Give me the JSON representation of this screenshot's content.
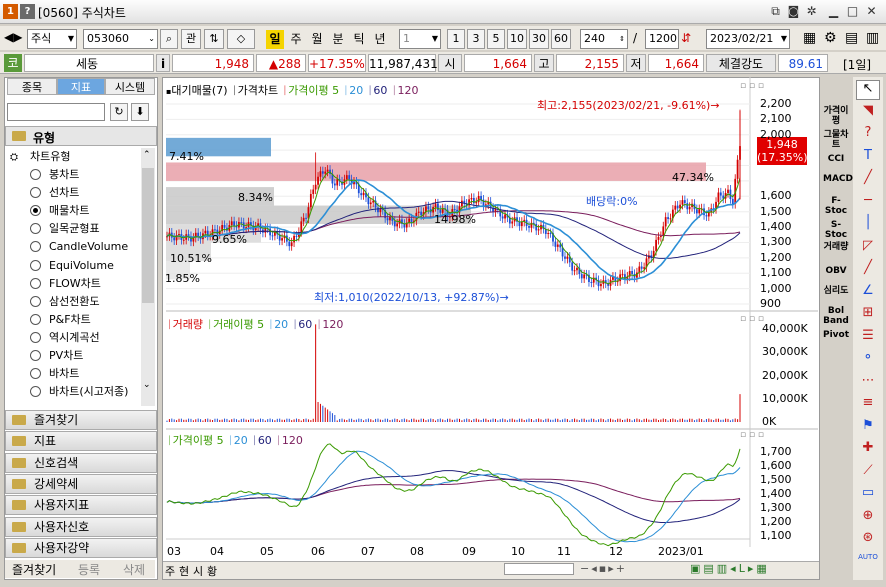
{
  "window": {
    "title": "[0560] 주식차트",
    "num_icon": "1",
    "help_icon": "?"
  },
  "toolbar": {
    "market": "주식",
    "code": "053060",
    "btn_gwan": "관",
    "periods": [
      "일",
      "주",
      "월",
      "분",
      "틱",
      "년"
    ],
    "interval": "1",
    "nums": [
      "1",
      "3",
      "5",
      "10",
      "30",
      "60"
    ],
    "count": "240",
    "slash": "/",
    "total": "1200",
    "date": "2023/02/21"
  },
  "quote": {
    "code_mark": "코",
    "name": "세동",
    "info": "i",
    "price": "1,948",
    "change": "▲288",
    "pct": "+17.35%",
    "volume": "11,987,431",
    "open_label": "시",
    "open": "1,664",
    "high_label": "고",
    "high": "2,155",
    "low_label": "저",
    "low": "1,664",
    "strength_label": "체결강도",
    "strength": "89.61",
    "period_tag": "[1일]"
  },
  "left": {
    "tabs": [
      "종목",
      "지표",
      "시스템"
    ],
    "section": "유형",
    "group": "차트유형",
    "chart_types": [
      "봉차트",
      "선차트",
      "매물차트",
      "일목균형표",
      "CandleVolume",
      "EquiVolume",
      "FLOW차트",
      "삼선전환도",
      "P&F차트",
      "역시계곡선",
      "PV차트",
      "바차트",
      "바차트(시고저종)"
    ],
    "selected": "매물차트",
    "accordion": [
      "즐겨찾기",
      "지표",
      "신호검색",
      "강세약세",
      "사용자지표",
      "사용자신호",
      "사용자강약"
    ],
    "bottom_tabs": [
      "즐겨찾기",
      "등록",
      "삭제"
    ]
  },
  "chart": {
    "price_legend": {
      "a": "대기매물(7)",
      "b": "가격차트",
      "c": "가격이평",
      "ma5": "5",
      "ma20": "20",
      "ma60": "60",
      "ma120": "120"
    },
    "vol_legend": {
      "a": "거래량",
      "b": "거래이평",
      "ma5": "5",
      "ma20": "20",
      "ma60": "60",
      "ma120": "120"
    },
    "ma_legend": {
      "a": "가격이평",
      "ma5": "5",
      "ma20": "20",
      "ma60": "60",
      "ma120": "120"
    },
    "high_note": "최고:2,155(2023/02/21, -9.61%)→",
    "low_note": "최저:1,010(2022/10/13, +92.87%)→",
    "div_note": "배당락:0%",
    "profile_pcts": [
      "7.41%",
      "47.34%",
      "8.34%",
      "14.98%",
      "9.65%",
      "10.51%",
      "1.85%"
    ],
    "price_ticks": [
      "2,200",
      "2,100",
      "2,000",
      "1,900",
      "1,800",
      "1,700",
      "1,600",
      "1,500",
      "1,400",
      "1,300",
      "1,200",
      "1,100",
      "1,000",
      "900"
    ],
    "current_price": "1,948",
    "current_pct": "(17.35%)",
    "vol_ticks": [
      "40,000K",
      "30,000K",
      "20,000K",
      "10,000K",
      "0K"
    ],
    "ma_ticks": [
      "1,700",
      "1,600",
      "1,500",
      "1,400",
      "1,300",
      "1,200",
      "1,100"
    ],
    "months": [
      "03",
      "04",
      "05",
      "06",
      "07",
      "08",
      "09",
      "10",
      "11",
      "12",
      "2023/01"
    ],
    "bottom_tabs": [
      "주",
      "현",
      "시",
      "황"
    ]
  },
  "indicators": [
    "가격이평",
    "그물차트",
    "CCI",
    "MACD",
    "F-Stoc",
    "S-Stoc",
    "거래량",
    "OBV",
    "심리도",
    "Bol Band",
    "Pivot"
  ],
  "colors": {
    "up": "#d40000",
    "down": "#1c4fd8",
    "ma5": "#3a9a00",
    "ma20": "#2c8fd6",
    "ma60": "#22227a",
    "ma120": "#7a1d5c",
    "profile_red": "#e8a0a8",
    "profile_blue": "#5b9bd0"
  }
}
